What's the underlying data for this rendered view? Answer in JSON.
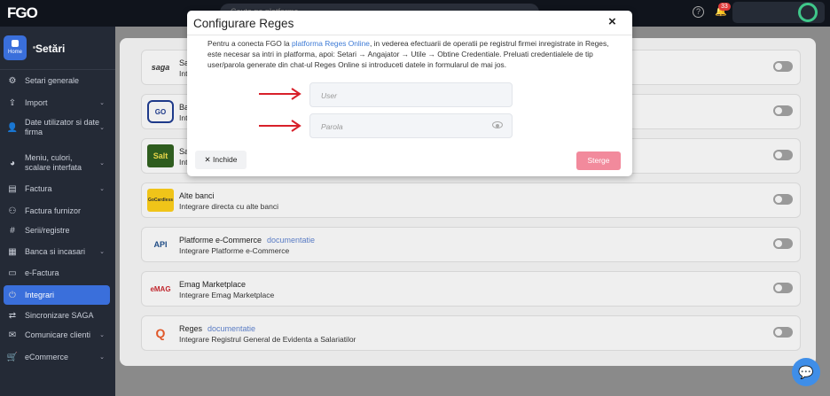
{
  "app": {
    "logo": "FGO",
    "search_placeholder": "Cauta pe platforma",
    "notif_count": "33"
  },
  "sidebar": {
    "home_label": "Home",
    "title": "Setări",
    "items": [
      {
        "label": "Setari generale",
        "icon": "gear-icon",
        "chevron": false
      },
      {
        "label": "Import",
        "icon": "upload-icon",
        "chevron": true
      },
      {
        "label": "Date utilizator si date firma",
        "icon": "user-icon",
        "chevron": true
      },
      {
        "label": "Meniu, culori, scalare interfata",
        "icon": "palette-icon",
        "chevron": true
      },
      {
        "label": "Factura",
        "icon": "document-icon",
        "chevron": true
      },
      {
        "label": "Factura furnizor",
        "icon": "supplier-icon",
        "chevron": false
      },
      {
        "label": "Serii/registre",
        "icon": "hash-icon",
        "chevron": false
      },
      {
        "label": "Banca si incasari",
        "icon": "bank-icon",
        "chevron": true
      },
      {
        "label": "e-Factura",
        "icon": "efactura-icon",
        "chevron": false
      },
      {
        "label": "Integrari",
        "icon": "plug-icon",
        "chevron": false,
        "active": true
      },
      {
        "label": "Sincronizare SAGA",
        "icon": "sync-icon",
        "chevron": false
      },
      {
        "label": "Comunicare clienti",
        "icon": "mail-icon",
        "chevron": true
      },
      {
        "label": "eCommerce",
        "icon": "cart-icon",
        "chevron": true
      }
    ]
  },
  "integrations": [
    {
      "logo": "saga",
      "title": "Sag",
      "doc": "",
      "desc": "Integr"
    },
    {
      "logo": "GO",
      "title": "Ban",
      "doc": "",
      "desc": "Integr"
    },
    {
      "logo": "Salt",
      "title": "Salt",
      "doc": "",
      "desc": "Inte"
    },
    {
      "logo": "GoCardless",
      "title": "Alte banci",
      "doc": "",
      "desc": "Integrare directa cu alte banci"
    },
    {
      "logo": "API",
      "title": "Platforme e-Commerce",
      "doc": "documentatie",
      "desc": "Integrare Platforme e-Commerce"
    },
    {
      "logo": "eMAG",
      "title": "Emag Marketplace",
      "doc": "",
      "desc": "Integrare Emag Marketplace"
    },
    {
      "logo": "Q",
      "title": "Reges",
      "doc": "documentatie",
      "desc": "Integrare Registrul General de Evidenta a Salariatilor"
    }
  ],
  "modal": {
    "title": "Configurare Reges",
    "close_icon": "×",
    "text_before": "Pentru a conecta FGO la ",
    "text_link": "platforma Reges Online",
    "text_after": ", in vederea efectuarii de operatii pe registrul firmei inregistrate in Reges, este necesar sa intri in platforma, apoi: Setari → Angajator → Utile → Obtine Credentiale. Preluati credentialele de tip user/parola generate din chat-ul Reges Online si introduceti datele in formularul de mai jos.",
    "user_placeholder": "User",
    "password_placeholder": "Parola",
    "close_button": "✕ Inchide",
    "delete_button": "Sterge"
  },
  "colors": {
    "accent": "#3a6fdb",
    "danger_button": "#f28a9c",
    "annotation_arrow": "#d8202a"
  }
}
